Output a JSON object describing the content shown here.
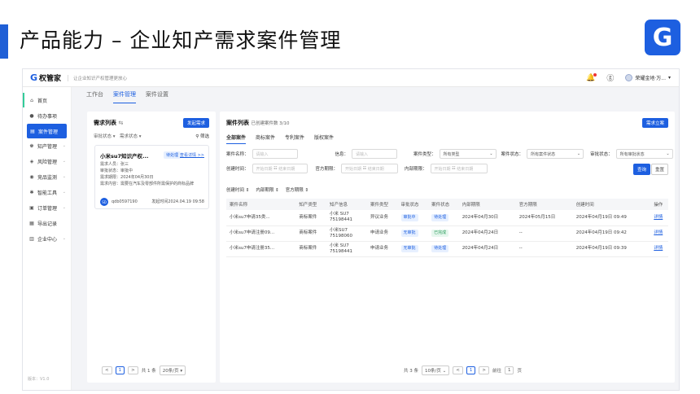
{
  "slide": {
    "title": "产品能力 – 企业知产需求案件管理",
    "logo_glyph": "G",
    "accent": "#1d5fe0"
  },
  "topbar": {
    "brand": "权管家",
    "brand_icon": "G",
    "slogan": "让企业知识产权管理更放心",
    "user": "荣耀金地·万..."
  },
  "sidebar": {
    "items": [
      {
        "icon": "home-icon",
        "glyph": "⌂",
        "label": "首页",
        "chevron": false
      },
      {
        "icon": "todo-icon",
        "glyph": "●",
        "label": "待办事项",
        "chevron": false
      },
      {
        "icon": "case-icon",
        "glyph": "▤",
        "label": "案件管理",
        "chevron": false,
        "active": true
      },
      {
        "icon": "ip-icon",
        "glyph": "♚",
        "label": "知产管理",
        "chevron": true
      },
      {
        "icon": "risk-icon",
        "glyph": "◈",
        "label": "风险管理",
        "chevron": true
      },
      {
        "icon": "monitor-icon",
        "glyph": "◉",
        "label": "竞品监测",
        "chevron": true
      },
      {
        "icon": "tool-icon",
        "glyph": "✱",
        "label": "智能工具",
        "chevron": true
      },
      {
        "icon": "order-icon",
        "glyph": "▣",
        "label": "订单管理",
        "chevron": true
      },
      {
        "icon": "export-icon",
        "glyph": "▦",
        "label": "导出记录",
        "chevron": false
      },
      {
        "icon": "enterprise-icon",
        "glyph": "▥",
        "label": "企业中心",
        "chevron": true
      }
    ],
    "version": "版本：V1.0"
  },
  "tabs": [
    "工作台",
    "案件管理",
    "案件设置"
  ],
  "left_panel": {
    "title": "需求列表",
    "new_btn": "发起需求",
    "filters": [
      "审批状态 ▾",
      "需求状态 ▾"
    ],
    "filter_btn": "筛选",
    "card": {
      "title": "小米su7知识产权...",
      "status": "待处理",
      "link": "查看详情 >>",
      "fields": [
        {
          "k": "需求人员：",
          "v": "张三"
        },
        {
          "k": "审批状态：",
          "v": "审批中"
        },
        {
          "k": "需求期限：",
          "v": "2024年04月30日"
        },
        {
          "k": "需求内容：",
          "v": "需要在汽车及零部件所需保护的商标品牌"
        }
      ],
      "avatar": "SD",
      "id": "qdb0597190",
      "time": "发起时间2024.04.19 09:58"
    },
    "pager": {
      "prev": "<",
      "page": "1",
      "next": ">",
      "total": "共 1 条",
      "size": "20条/页"
    }
  },
  "right_panel": {
    "title": "案件列表",
    "subtitle": "已创建案件数 3/10",
    "new_btn": "需求立案",
    "subtabs": [
      "全部案件",
      "商标案件",
      "专利案件",
      "版权案件"
    ],
    "filters_row1": [
      {
        "label": "案件名称：",
        "ph": "请输入"
      },
      {
        "label": "信息：",
        "ph": "请输入"
      },
      {
        "label": "案件类型：",
        "value": "所有类型"
      },
      {
        "label": "案件状态：",
        "value": "所有案件状态"
      },
      {
        "label": "审批状态：",
        "value": "所有审批状态"
      }
    ],
    "filters_row2": [
      {
        "label": "创建时间：",
        "start": "开始日期",
        "end": "结束日期"
      },
      {
        "label": "官方期限：",
        "start": "开始日期",
        "end": "结束日期"
      },
      {
        "label": "内部期限：",
        "start": "开始日期",
        "end": "结束日期"
      }
    ],
    "query_btn": "查询",
    "reset_btn": "重置",
    "sorts": [
      "创建时间 ⇕",
      "内部期限 ⇕",
      "官方期限 ⇕"
    ],
    "columns": [
      "案件名称",
      "知产类型",
      "知产信息",
      "案件类型",
      "审批状态",
      "案件状态",
      "内部期限",
      "官方期限",
      "创建时间",
      "操作"
    ],
    "rows": [
      [
        "小米su7申请35类...",
        "商标案件",
        "小米 SU7 75198441",
        "异议业务",
        "审批中",
        "待处理",
        "2024年04月30日",
        "2024年05月15日",
        "2024年04月19日 09:49",
        "详情"
      ],
      [
        "小米su7申请注册09...",
        "商标案件",
        "小米SU7 75198060",
        "申请业务",
        "无审批",
        "已完成",
        "2024年04月24日",
        "--",
        "2024年04月19日 09:42",
        "详情"
      ],
      [
        "小米su7申请注册35...",
        "商标案件",
        "小米 SU7 75198441",
        "申请业务",
        "无审批",
        "待处理",
        "2024年04月24日",
        "--",
        "2024年04月19日 09:39",
        "详情"
      ]
    ],
    "pager": {
      "total": "共 3 条",
      "size": "10条/页",
      "prev": "<",
      "page": "1",
      "next": ">",
      "goto": "前往",
      "goto_page": "1",
      "unit": "页"
    }
  }
}
